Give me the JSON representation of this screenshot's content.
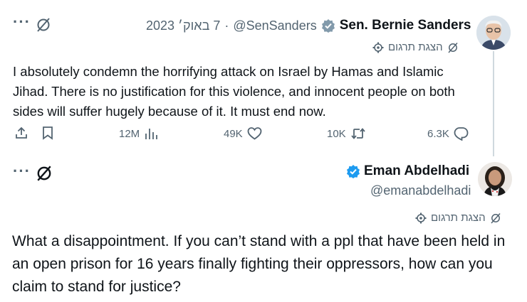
{
  "tweets": [
    {
      "author_name": "Sen. Bernie Sanders",
      "handle": "@SenSanders",
      "date": "7 באוק׳ 2023",
      "separator": "·",
      "translate_label": "הצגת תרגום",
      "text": "I absolutely condemn the horrifying attack on Israel by Hamas and Islamic Jihad. There is no justification for this violence, and innocent people on both sides will suffer hugely because of it. It must end now.",
      "stats": {
        "replies": "6.3K",
        "reposts": "10K",
        "likes": "49K",
        "views": "12M"
      }
    },
    {
      "author_name": "Eman Abdelhadi",
      "handle": "@emanabdelhadi",
      "translate_label": "הצגת תרגום",
      "text": "What a disappointment. If you can’t stand with a ppl that have been held in an open prison for 16 years finally fighting their oppressors, how can you claim to stand for justice?"
    }
  ],
  "colors": {
    "verified": "#1d9bf0",
    "text": "#0f1419",
    "muted": "#536471"
  },
  "icons": {
    "more": "more-dots-icon",
    "grok": "grok-slash-icon",
    "verified": "verified-badge-icon",
    "translate": "globe-gear-icon",
    "reply": "reply-icon",
    "repost": "repost-icon",
    "like": "heart-icon",
    "views": "views-chart-icon",
    "bookmark": "bookmark-icon",
    "share": "share-icon"
  }
}
